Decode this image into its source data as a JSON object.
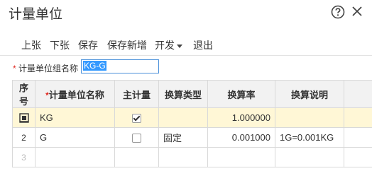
{
  "dialog": {
    "title": "计量单位"
  },
  "toolbar": {
    "prev": "上张",
    "next": "下张",
    "save": "保存",
    "save_new": "保存新增",
    "dev": "开发",
    "exit": "退出"
  },
  "form": {
    "group_name_label": "计量单位组名称",
    "group_name_value": "KG-G"
  },
  "grid": {
    "headers": {
      "seq": "序号",
      "unit_name": "计量单位名称",
      "primary": "主计量",
      "conv_type": "换算类型",
      "rate": "换算率",
      "desc": "换算说明"
    },
    "rows": [
      {
        "seq": "",
        "unit_name": "KG",
        "primary": true,
        "conv_type": "",
        "rate": "1.000000",
        "desc": ""
      },
      {
        "seq": "2",
        "unit_name": "G",
        "primary": false,
        "conv_type": "固定",
        "rate": "0.001000",
        "desc": "1G=0.001KG"
      },
      {
        "seq": "3",
        "unit_name": "",
        "primary": null,
        "conv_type": "",
        "rate": "",
        "desc": ""
      }
    ]
  }
}
